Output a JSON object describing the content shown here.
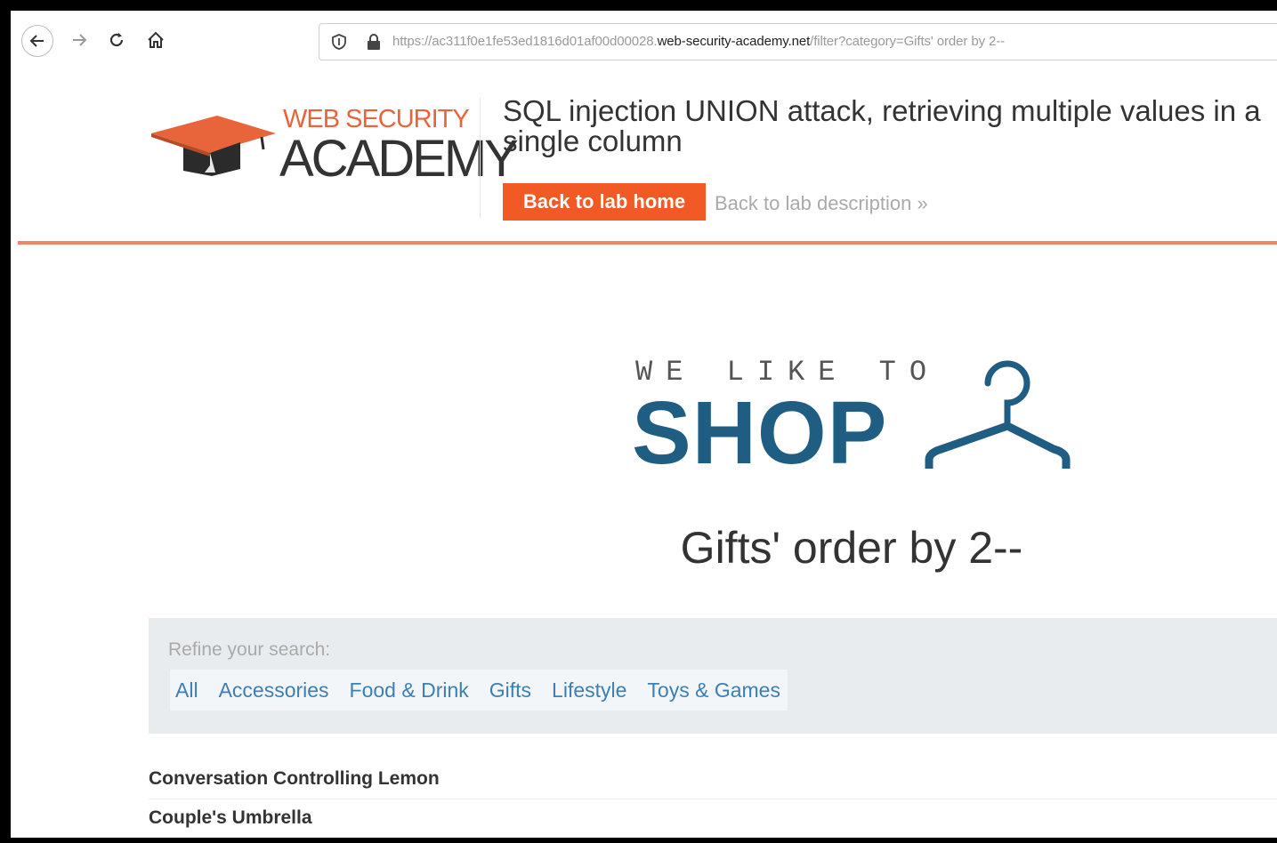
{
  "browser": {
    "url_prefix": "https://ac311f0e1fe53ed1816d01af00d00028.",
    "url_domain": "web-security-academy.net",
    "url_path": "/filter?category=Gifts' order by 2--"
  },
  "logo": {
    "line1": "WEB SECURITY",
    "line2": "ACADEMY"
  },
  "lab": {
    "title": "SQL injection UNION attack, retrieving multiple values in a single column",
    "back_home": "Back to lab home",
    "back_description": "Back to lab description »"
  },
  "hero": {
    "tagline": "WE LIKE TO",
    "shop": "SHOP"
  },
  "page": {
    "heading": "Gifts' order by 2--"
  },
  "filters": {
    "label": "Refine your search:",
    "items": [
      "All",
      "Accessories",
      "Food & Drink",
      "Gifts",
      "Lifestyle",
      "Toys & Games"
    ]
  },
  "products": [
    "Conversation Controlling Lemon",
    "Couple's Umbrella"
  ],
  "colors": {
    "accent": "#f15a24",
    "shop_blue": "#1f5e82",
    "link_blue": "#3c7fb4"
  }
}
